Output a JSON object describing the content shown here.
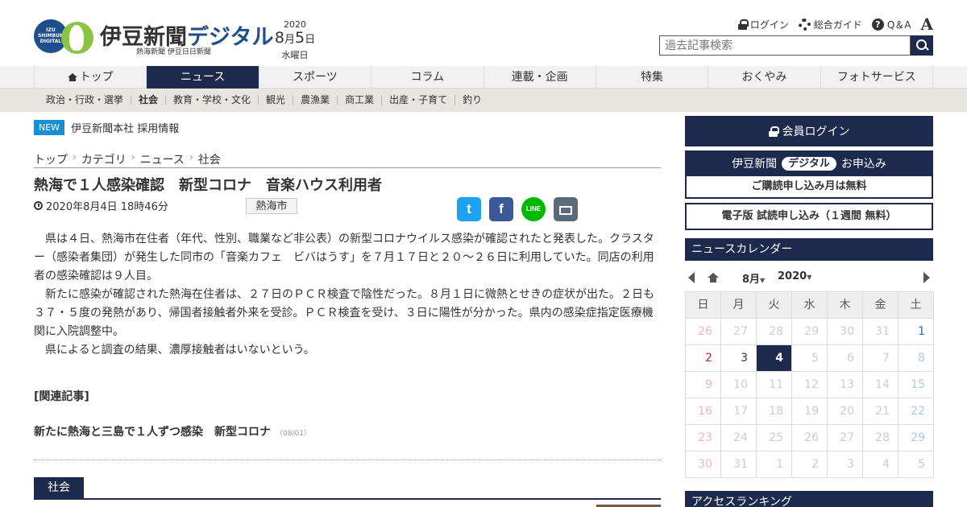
{
  "header": {
    "logo_circle": "IZU SHIMBUN DIGITAL",
    "logo_main": "伊豆新聞",
    "logo_digital": "デジタル",
    "logo_sub": "熱海新聞 伊豆日日新聞",
    "date_year": "2020",
    "date_month": "8",
    "date_month_unit": "月",
    "date_day": "5",
    "date_day_unit": "日",
    "date_weekday": "水曜日",
    "util": {
      "login": "ログイン",
      "guide": "総合ガイド",
      "qa": "Q＆A",
      "font_size": "A"
    },
    "search_placeholder": "過去記事検索"
  },
  "nav": {
    "items": [
      {
        "label": "トップ"
      },
      {
        "label": "ニュース"
      },
      {
        "label": "スポーツ"
      },
      {
        "label": "コラム"
      },
      {
        "label": "連載・企画"
      },
      {
        "label": "特集"
      },
      {
        "label": "おくやみ"
      },
      {
        "label": "フォトサービス"
      }
    ],
    "active": "ニュース"
  },
  "subnav": {
    "items": [
      "政治・行政・選挙",
      "社会",
      "教育・学校・文化",
      "観光",
      "農漁業",
      "商工業",
      "出産・子育て",
      "釣り"
    ],
    "active": "社会"
  },
  "notice": {
    "badge": "NEW",
    "text": "伊豆新聞本社 採用情報"
  },
  "breadcrumb": [
    "トップ",
    "カテゴリ",
    "ニュース",
    "社会"
  ],
  "article": {
    "title": "熱海で１人感染確認　新型コロナ　音楽ハウス利用者",
    "datetime": "2020年8月4日 18時46分",
    "tag": "熱海市",
    "paragraphs": [
      "県は４日、熱海市在住者（年代、性別、職業など非公表）の新型コロナウイルス感染が確認されたと発表した。クラスター（感染者集団）が発生した同市の「音楽カフェ　ビバはうす」を７月１７日と２０～２６日に利用していた。同店の利用者の感染確認は９人目。",
      "新たに感染が確認された熱海在住者は、２７日のＰＣＲ検査で陰性だった。８月１日に微熱とせきの症状が出た。２日も３７・５度の発熱があり、帰国者接触者外来を受診。ＰＣＲ検査を受け、３日に陽性が分かった。県内の感染症指定医療機関に入院調整中。",
      "県によると調査の結果、濃厚接触者はいないという。"
    ],
    "related_heading": "[関連記事]",
    "related": [
      {
        "title": "新たに熱海と三島で１人ずつ感染　新型コロナ",
        "date": "（08/01）"
      }
    ],
    "section_label": "社会"
  },
  "share": {
    "twitter": "t",
    "facebook": "f",
    "line": "LINE"
  },
  "sidebar": {
    "login": "会員ログイン",
    "subscribe_left": "伊豆新聞",
    "subscribe_pill": "デジタル",
    "subscribe_right": "お申込み",
    "subscribe_free": "ご購読申し込み月は無料",
    "trial": "電子版 試読申し込み（１週間 無料）",
    "calendar_title": "ニュースカレンダー",
    "calendar_month": "8月",
    "calendar_year": "2020",
    "weekdays": [
      "日",
      "月",
      "火",
      "水",
      "木",
      "金",
      "土"
    ],
    "weeks": [
      [
        "26",
        "27",
        "28",
        "29",
        "30",
        "31",
        "1"
      ],
      [
        "2",
        "3",
        "4",
        "5",
        "6",
        "7",
        "8"
      ],
      [
        "9",
        "10",
        "11",
        "12",
        "13",
        "14",
        "15"
      ],
      [
        "16",
        "17",
        "18",
        "19",
        "20",
        "21",
        "22"
      ],
      [
        "23",
        "24",
        "25",
        "26",
        "27",
        "28",
        "29"
      ],
      [
        "30",
        "31",
        "1",
        "2",
        "3",
        "4",
        "5"
      ]
    ],
    "ranking_title": "アクセスランキング"
  },
  "colors": {
    "navy": "#1d2a4d",
    "new_badge": "#1a8fd0",
    "twitter": "#1da1f2",
    "facebook": "#3b5998",
    "line": "#00b900"
  }
}
